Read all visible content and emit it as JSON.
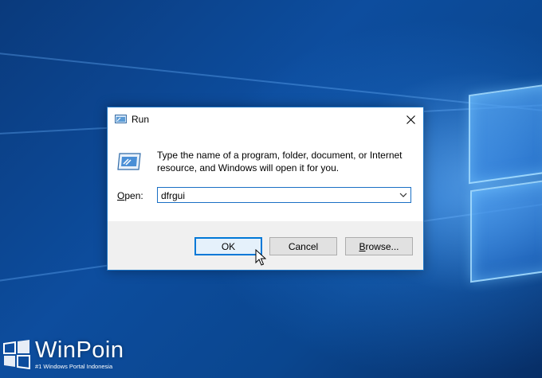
{
  "dialog": {
    "title": "Run",
    "title_icon": "run-icon",
    "close_icon": "close-icon",
    "description": "Type the name of a program, folder, document, or Internet resource, and Windows will open it for you.",
    "open_label_mnemonic": "O",
    "open_label_rest": "pen:",
    "open_value": "dfrgui",
    "buttons": {
      "ok": "OK",
      "cancel": "Cancel",
      "browse_mnemonic": "B",
      "browse_rest": "rowse..."
    }
  },
  "watermark": {
    "name": "WinPoin",
    "tagline": "#1 Windows Portal Indonesia"
  },
  "colors": {
    "accent": "#0078d7",
    "desktop": "#0a3f86",
    "footer": "#f0f0f0"
  }
}
